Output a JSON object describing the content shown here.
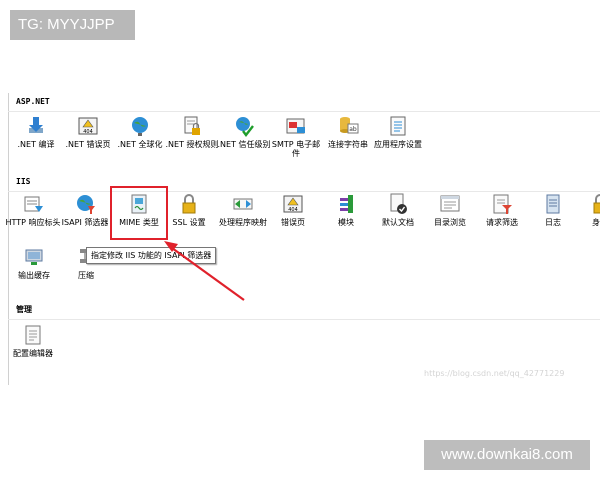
{
  "badge": "TG: MYYJJPP",
  "watermark": "www.downkai8.com",
  "url_watermark": "https://blog.csdn.net/qq_42771229",
  "tooltip": "指定修改 IIS 功能的 ISAPI 筛选器",
  "sections": {
    "aspnet": "ASP.NET",
    "iis": "IIS",
    "manage": "管理"
  },
  "aspnet_items": [
    {
      "label": ".NET 编译",
      "icon": "download-arrow-icon"
    },
    {
      "label": ".NET 错误页",
      "icon": "error-page-404-icon"
    },
    {
      "label": ".NET 全球化",
      "icon": "globe-icon"
    },
    {
      "label": ".NET 授权规则",
      "icon": "lock-document-icon"
    },
    {
      "label": ".NET 信任级别",
      "icon": "trust-shield-icon"
    },
    {
      "label": "SMTP 电子邮件",
      "icon": "email-icon"
    },
    {
      "label": "连接字符串",
      "icon": "connection-string-icon"
    },
    {
      "label": "应用程序设置",
      "icon": "app-settings-icon"
    }
  ],
  "iis_items": [
    {
      "label": "HTTP 响应标头",
      "icon": "http-headers-icon"
    },
    {
      "label": "ISAPI 筛选器",
      "icon": "isapi-filter-icon"
    },
    {
      "label": "MIME 类型",
      "icon": "mime-type-icon"
    },
    {
      "label": "SSL 设置",
      "icon": "padlock-icon"
    },
    {
      "label": "处理程序映射",
      "icon": "handler-mapping-icon"
    },
    {
      "label": "错误页",
      "icon": "error-page-icon"
    },
    {
      "label": "模块",
      "icon": "modules-icon"
    },
    {
      "label": "默认文档",
      "icon": "default-document-icon"
    },
    {
      "label": "目录浏览",
      "icon": "directory-browse-icon"
    },
    {
      "label": "请求筛选",
      "icon": "request-filter-icon"
    },
    {
      "label": "日志",
      "icon": "log-icon"
    },
    {
      "label": "身份",
      "icon": "auth-lock-icon"
    },
    {
      "label": "输出缓存",
      "icon": "output-cache-icon"
    },
    {
      "label": "压缩",
      "icon": "compression-icon"
    }
  ],
  "manage_items": [
    {
      "label": "配置编辑器",
      "icon": "config-editor-icon"
    }
  ],
  "colors": {
    "highlight": "#e0212b",
    "arrow": "#e0212b"
  }
}
